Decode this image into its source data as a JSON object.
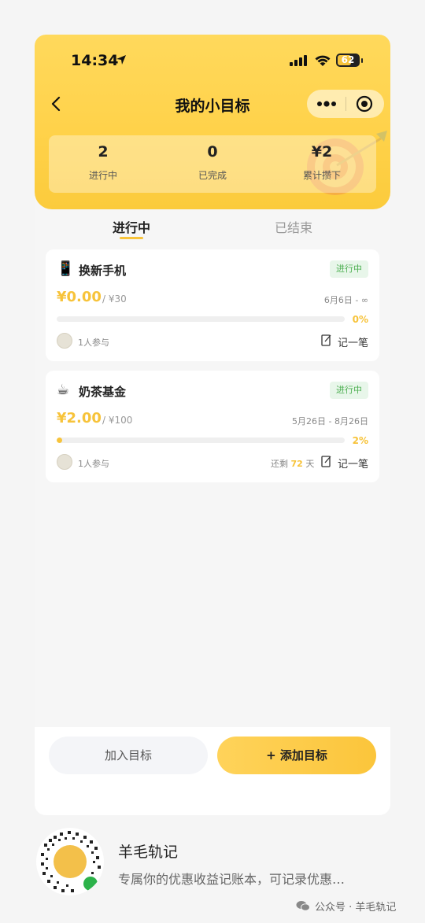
{
  "status": {
    "time": "14:34",
    "battery": "62"
  },
  "nav": {
    "title": "我的小目标"
  },
  "stats": [
    {
      "value": "2",
      "label": "进行中"
    },
    {
      "value": "0",
      "label": "已完成"
    },
    {
      "value": "¥2",
      "label": "累计攒下"
    }
  ],
  "tabs": {
    "active": "进行中",
    "inactive": "已结束"
  },
  "goals": [
    {
      "emoji": "📱",
      "name": "换新手机",
      "status": "进行中",
      "saved": "¥0.00",
      "target": "/ ¥30",
      "dates": "6月6日 - ∞",
      "progress_percent": 0,
      "progress_label": "0%",
      "participants": "1人参与",
      "record": "记一笔"
    },
    {
      "emoji": "☕",
      "name": "奶茶基金",
      "status": "进行中",
      "saved": "¥2.00",
      "target": "/ ¥100",
      "dates": "5月26日 - 8月26日",
      "progress_percent": 2,
      "progress_label": "2%",
      "participants": "1人参与",
      "remaining_prefix": "还剩",
      "remaining_days": "72",
      "remaining_suffix": "天",
      "record": "记一笔"
    }
  ],
  "buttons": {
    "join": "加入目标",
    "add": "+ 添加目标"
  },
  "promo": {
    "name": "羊毛轨记",
    "description": "专属你的优惠收益记账本，可记录优惠…",
    "watermark": "公众号 · 羊毛轨记"
  },
  "colors": {
    "accent": "#f7c33a",
    "header": "#ffd95c",
    "badge_bg": "#e8f6ea",
    "badge_text": "#4caf50"
  }
}
